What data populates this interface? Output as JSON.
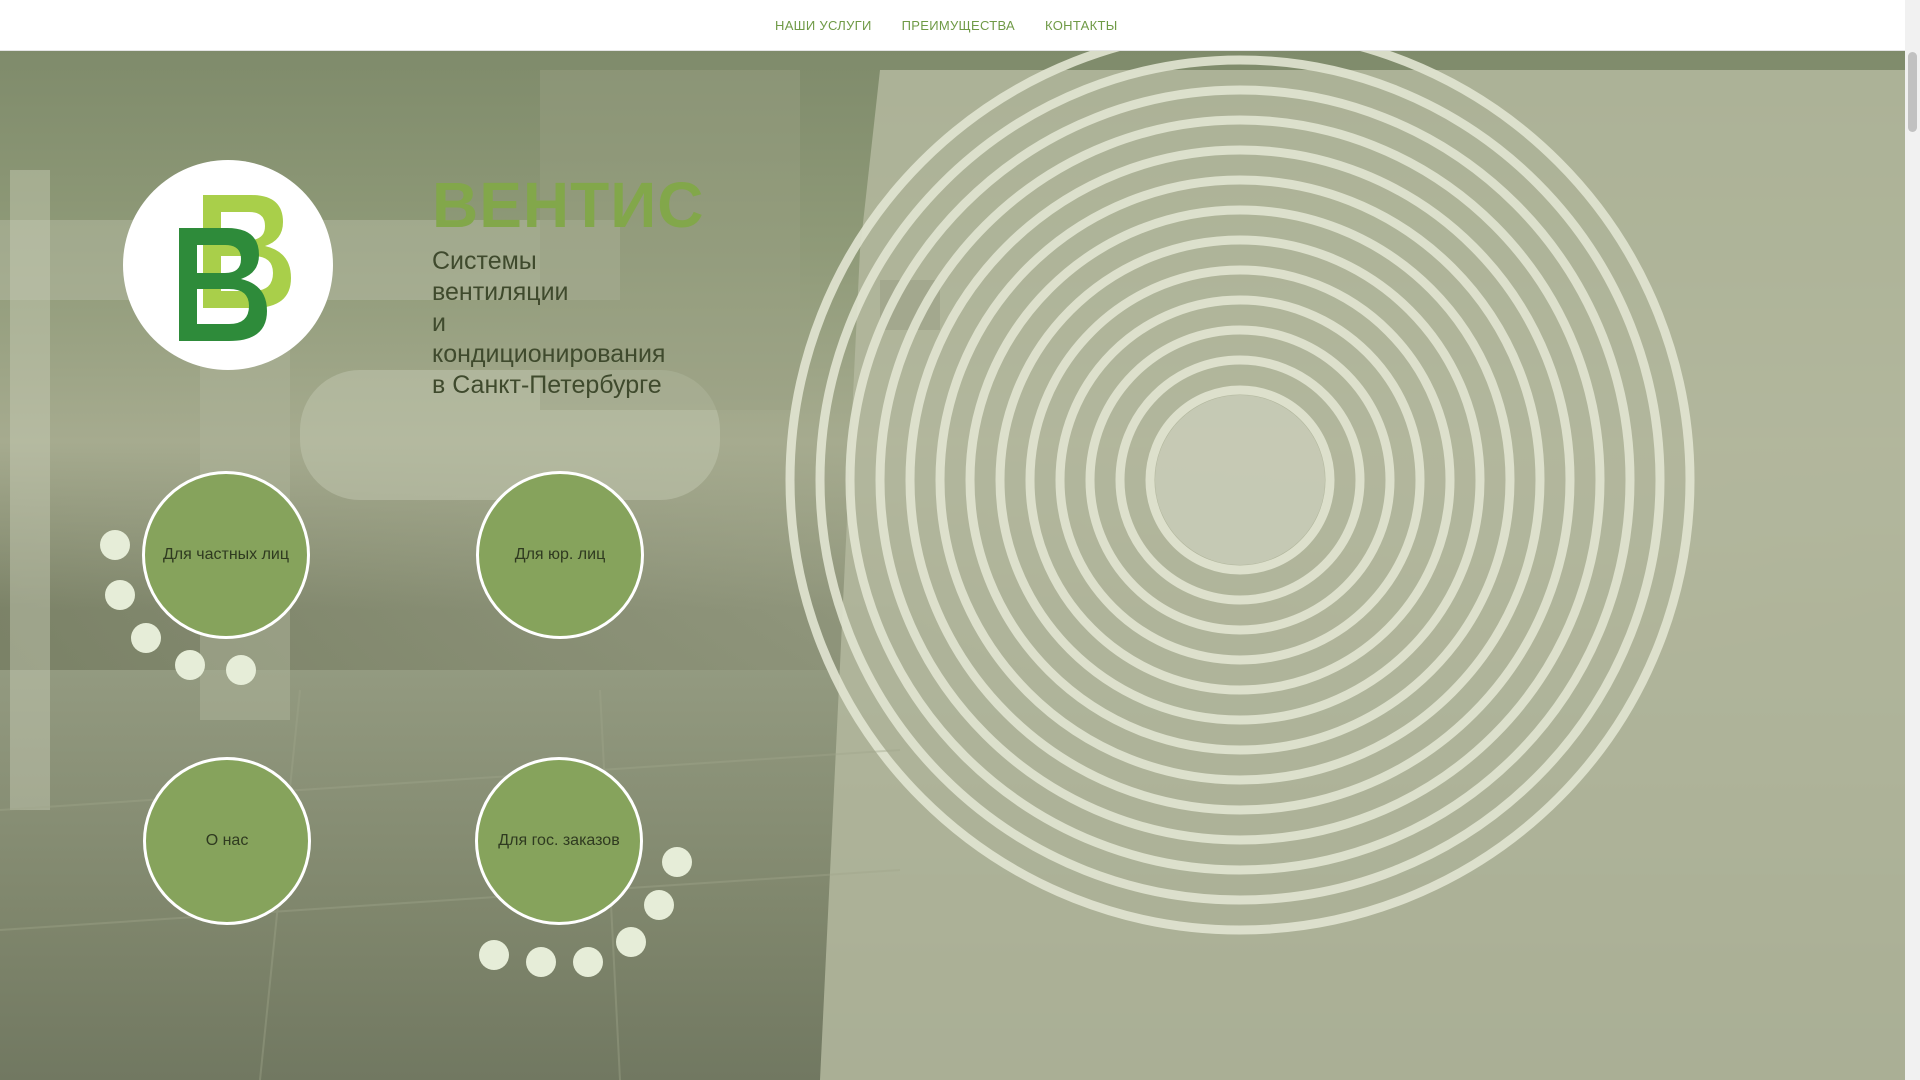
{
  "nav": {
    "items": [
      {
        "label": "НАШИ УСЛУГИ"
      },
      {
        "label": "ПРЕИМУЩЕСТВА"
      },
      {
        "label": "КОНТАКТЫ"
      }
    ]
  },
  "hero": {
    "brand": "ВЕНТИС",
    "tagline_lines": [
      "Системы",
      "вентиляции",
      "и",
      "кондиционирования",
      "в Санкт-Петербурге"
    ]
  },
  "bubbles": {
    "private": "Для частных лиц",
    "legal": "Для юр. лиц",
    "about": "О нас",
    "government": "Для гос. заказов"
  },
  "colors": {
    "accent": "#82a74a",
    "bubble": "#86a35c",
    "nav_text": "#6f9a46",
    "logo_dark": "#2e8b3a",
    "logo_light": "#a9cf4a"
  },
  "icons": {
    "logo": "double-b-logo-icon"
  }
}
